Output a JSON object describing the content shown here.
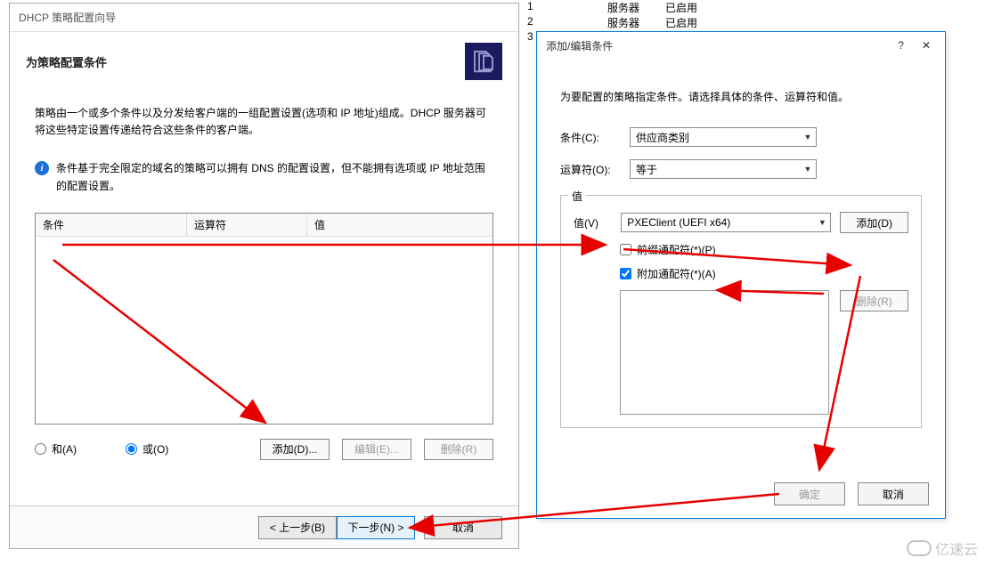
{
  "bg": {
    "rows": [
      {
        "n": "1",
        "c1": "服务器",
        "c2": "已启用"
      },
      {
        "n": "2",
        "c1": "服务器",
        "c2": "已启用"
      },
      {
        "n": "3",
        "c1": "",
        "c2": ""
      }
    ]
  },
  "wizard": {
    "title": "DHCP 策略配置向导",
    "header": "为策略配置条件",
    "desc": "策略由一个或多个条件以及分发给客户端的一组配置设置(选项和 IP 地址)组成。DHCP 服务器可将这些特定设置传递给符合这些条件的客户端。",
    "info": "条件基于完全限定的域名的策略可以拥有 DNS 的配置设置，但不能拥有选项或 IP 地址范围的配置设置。",
    "table": {
      "cond": "条件",
      "op": "运算符",
      "val": "值"
    },
    "radio_and": "和(A)",
    "radio_or": "或(O)",
    "btn_add": "添加(D)...",
    "btn_edit": "编辑(E)...",
    "btn_del": "删除(R)",
    "btn_back": "< 上一步(B)",
    "btn_next": "下一步(N) >",
    "btn_cancel": "取消"
  },
  "dialog": {
    "title": "添加/编辑条件",
    "help": "?",
    "close": "✕",
    "instr": "为要配置的策略指定条件。请选择具体的条件、运算符和值。",
    "label_cond": "条件(C):",
    "sel_cond": "供应商类别",
    "label_op": "运算符(O):",
    "sel_op": "等于",
    "fieldset": "值",
    "label_val": "值(V)",
    "sel_val": "PXEClient (UEFI x64)",
    "btn_add": "添加(D)",
    "chk_prefix": "前缀通配符(*)(P)",
    "chk_append": "附加通配符(*)(A)",
    "btn_remove": "删除(R)",
    "btn_ok": "确定",
    "btn_cancel": "取消"
  },
  "watermark": "亿速云",
  "info_glyph": "i"
}
